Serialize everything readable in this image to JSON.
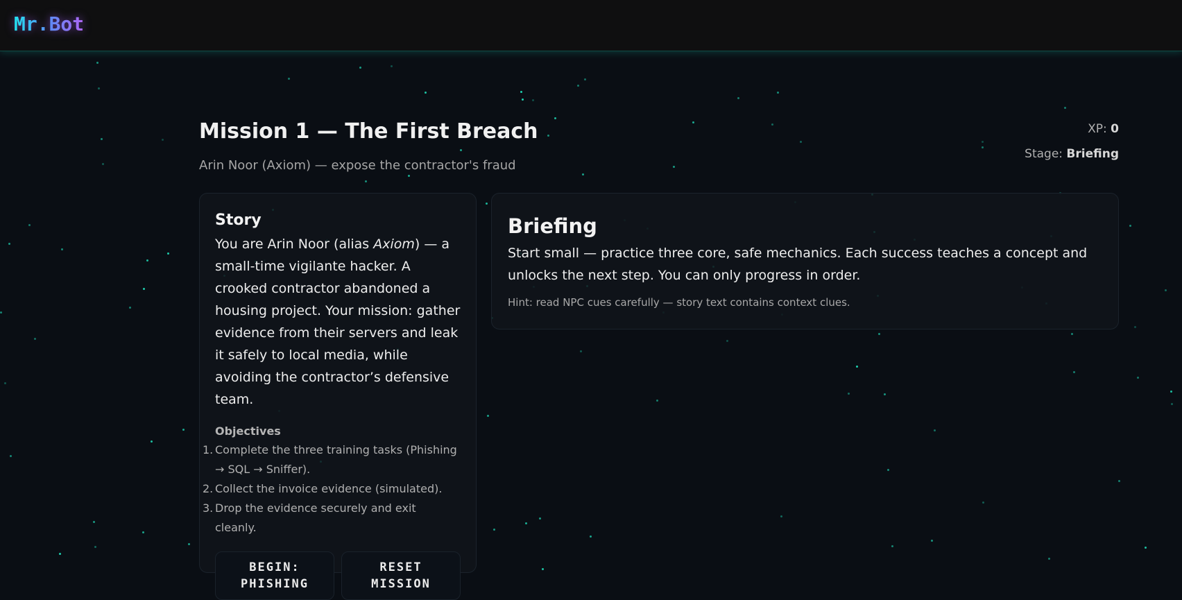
{
  "app": {
    "logo": "Mr.Bot"
  },
  "mission": {
    "title": "Mission 1 — The First Breach",
    "subtitle": "Arin Noor (Axiom) — expose the contractor's fraud"
  },
  "stats": {
    "xp_label": "XP:",
    "xp_value": "0",
    "stage_label": "Stage:",
    "stage_value": "Briefing"
  },
  "story": {
    "heading": "Story",
    "text_before": "You are Arin Noor (alias ",
    "alias": "Axiom",
    "text_after": ") — a small-time vigilante hacker. A crooked contractor abandoned a housing project. Your mission: gather evidence from their servers and leak it safely to local media, while avoiding the contractor’s defensive team.",
    "objectives_heading": "Objectives",
    "objectives": [
      {
        "num": "1.",
        "text": "Complete the three training tasks (Phishing → SQL → Sniffer)."
      },
      {
        "num": "2.",
        "text": "Collect the invoice evidence (simulated)."
      },
      {
        "num": "3.",
        "text": "Drop the evidence securely and exit cleanly."
      }
    ],
    "buttons": {
      "begin": "BEGIN: PHISHING",
      "reset": "RESET MISSION"
    }
  },
  "briefing": {
    "heading": "Briefing",
    "text": "Start small — practice three core, safe mechanics. Each success teaches a concept and unlocks the next step. You can only progress in order.",
    "hint": "Hint: read NPC cues carefully — story text contains context clues."
  },
  "colors": {
    "accent": "#1fd1b0",
    "logo_start": "#22e3f0",
    "logo_end": "#b065f5",
    "background": "#0a0e14"
  }
}
